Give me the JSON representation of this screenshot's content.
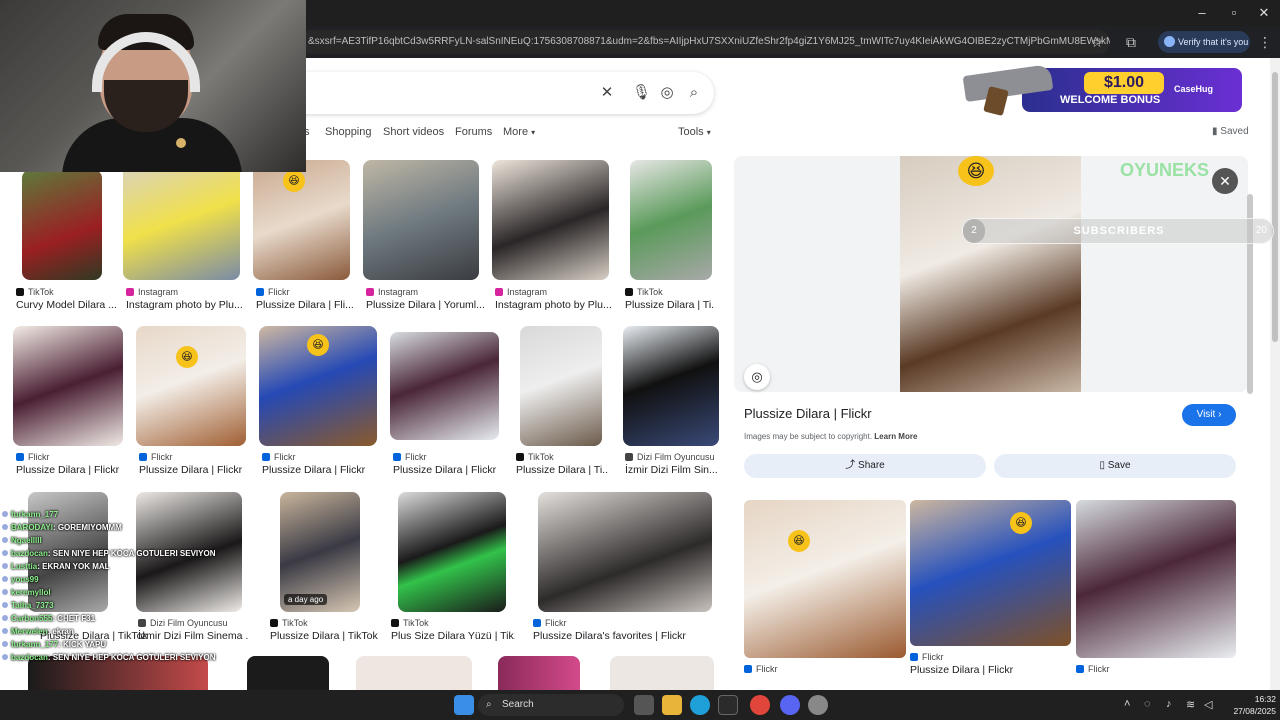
{
  "browser": {
    "url": "&sxsrf=AE3TifP16qbtCd3w5RRFyLN-salSnINEuQ:1756308708871&udm=2&fbs=AIIjpHxU7SXXniUZfeShr2fp4giZ1Y6MJ25_tmWITc7uy4KIeiAkWG4OIBE2zyCTMjPbGmMU8EWskMk2JSE_efd...",
    "verify_label": "Verify that it's you"
  },
  "search": {
    "filters": [
      "Shopping",
      "Short videos",
      "Forums",
      "More"
    ],
    "filter_partial": "s",
    "tools_label": "Tools",
    "saved_label": "Saved"
  },
  "results": {
    "row1": [
      {
        "source": "TikTok",
        "title": "Curvy Model Dilara ..."
      },
      {
        "source": "Instagram",
        "title": "Instagram photo by Plu..."
      },
      {
        "source": "Flickr",
        "title": "Plussize Dilara | Fli..."
      },
      {
        "source": "Instagram",
        "title": "Plussize Dilara | Yoruml..."
      },
      {
        "source": "Instagram",
        "title": "Instagram photo by Plu..."
      },
      {
        "source": "TikTok",
        "title": "Plussize Dilara | Ti..."
      }
    ],
    "row2": [
      {
        "source": "Flickr",
        "title": "Plussize Dilara | Flickr"
      },
      {
        "source": "Flickr",
        "title": "Plussize Dilara | Flickr"
      },
      {
        "source": "Flickr",
        "title": "Plussize Dilara | Flickr"
      },
      {
        "source": "Flickr",
        "title": "Plussize Dilara | Flickr"
      },
      {
        "source": "TikTok",
        "title": "Plussize Dilara | Ti..."
      },
      {
        "source": "Dizi Film Oyuncusu",
        "title": "İzmir Dizi Film Sin..."
      }
    ],
    "row3": [
      {
        "source": "",
        "title": "Plussize Dilara | TikTok"
      },
      {
        "source": "Dizi Film Oyuncusu",
        "title": "İzmir Dizi Film Sinema ..."
      },
      {
        "source": "TikTok",
        "title": "Plussize Dilara | TikTok",
        "badge": "a day ago"
      },
      {
        "source": "TikTok",
        "title": "Plus Size Dilara Yüzü | Tik..."
      },
      {
        "source": "Flickr",
        "title": "Plussize Dilara's favorites | Flickr"
      }
    ]
  },
  "panel": {
    "title": "Plussize Dilara | Flickr",
    "visit_label": "Visit",
    "copyright": "Images may be subject to copyright.",
    "learn_more": "Learn More",
    "share_label": "Share",
    "save_label": "Save",
    "related": [
      {
        "source": "Flickr",
        "title": ""
      },
      {
        "source": "Flickr",
        "title": "Plussize Dilara | Flickr"
      },
      {
        "source": "Flickr",
        "title": ""
      }
    ]
  },
  "overlays": {
    "subscribers_label": "SUBSCRIBERS",
    "sub_left": "2",
    "sub_right": "20",
    "oyuncu_text": "OYUNEKS",
    "bonus_amount": "$1.00",
    "bonus_text": "WELCOME BONUS",
    "bonus_brand": "CaseHug"
  },
  "chat": [
    {
      "user": "furkann_177",
      "msg": ""
    },
    {
      "user": "BARODAYI",
      "msg": ": GOREMIYOMMM"
    },
    {
      "user": "Ngaelllll",
      "msg": ""
    },
    {
      "user": "bazdocan",
      "msg": ": SEN NIYE HEP KOCA GOTULERI SEVIYON"
    },
    {
      "user": "Lusttia",
      "msg": ": EKRAN YOK MAL"
    },
    {
      "user": "yous99",
      "msg": ""
    },
    {
      "user": "keremyllol",
      "msg": ""
    },
    {
      "user": "Talha_7373",
      "msg": ""
    },
    {
      "user": "Carbon555",
      "msg": ": CHET F31"
    },
    {
      "user": "Merwelen",
      "msg": ": ekran"
    },
    {
      "user": "furkann_177",
      "msg": ": KICK YAPU"
    },
    {
      "user": "bazdocan",
      "msg": ": SEN NIYE HEP KOCA GOTULERI SEVIYON"
    }
  ],
  "taskbar": {
    "search_label": "Search",
    "time": "16:32",
    "date": "27/08/2025"
  },
  "colors": {
    "accent": "#1a73e8",
    "chrome": "#202124",
    "taskbar": "#202020"
  }
}
